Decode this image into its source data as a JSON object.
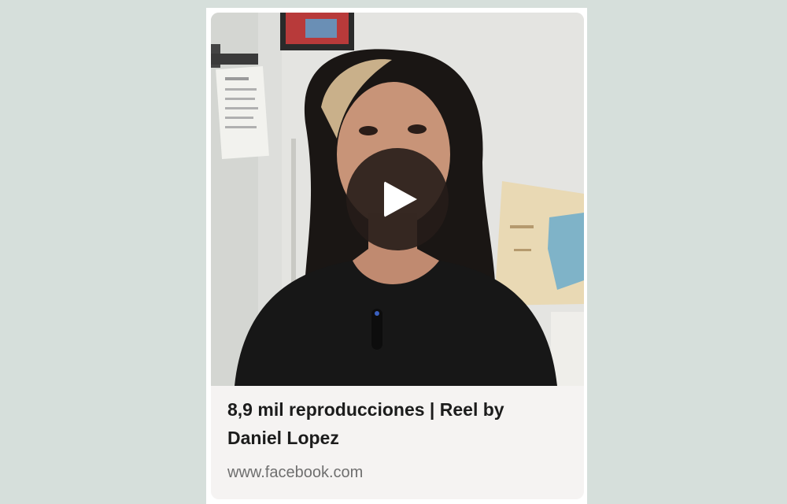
{
  "card": {
    "caption": "8,9 mil reproducciones | Reel by Daniel Lopez",
    "source": "www.facebook.com"
  },
  "video": {
    "play_icon": "play-icon"
  },
  "colors": {
    "page_background": "#d6dfdb",
    "card_background": "#f5f3f2",
    "caption_text": "#1c1c1c",
    "source_text": "#6f6f6f",
    "play_button": "#261c18"
  }
}
